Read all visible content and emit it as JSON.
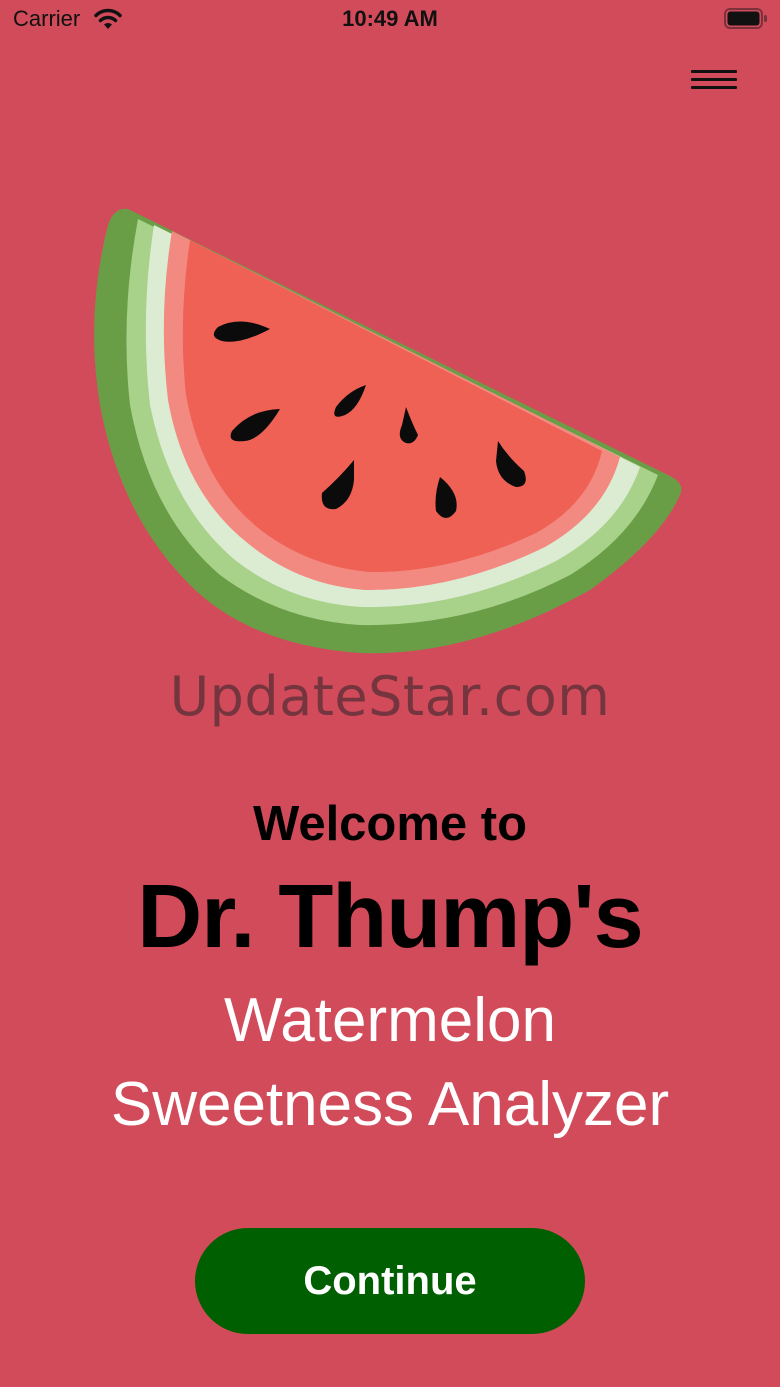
{
  "status_bar": {
    "carrier": "Carrier",
    "time": "10:49 AM"
  },
  "icons": {
    "wifi": "wifi-icon",
    "battery": "battery-icon",
    "menu": "hamburger-menu-icon",
    "hero": "watermelon-slice-icon"
  },
  "watermark": "UpdateStar.com",
  "welcome": {
    "greeting": "Welcome to",
    "app_name": "Dr. Thump's",
    "subtitle_line1": "Watermelon",
    "subtitle_line2": "Sweetness Analyzer"
  },
  "actions": {
    "continue_label": "Continue"
  },
  "colors": {
    "background": "#d24b5a",
    "continue_button": "#005f00",
    "flesh": "#ef6154",
    "rind_dark": "#6a9e46"
  }
}
